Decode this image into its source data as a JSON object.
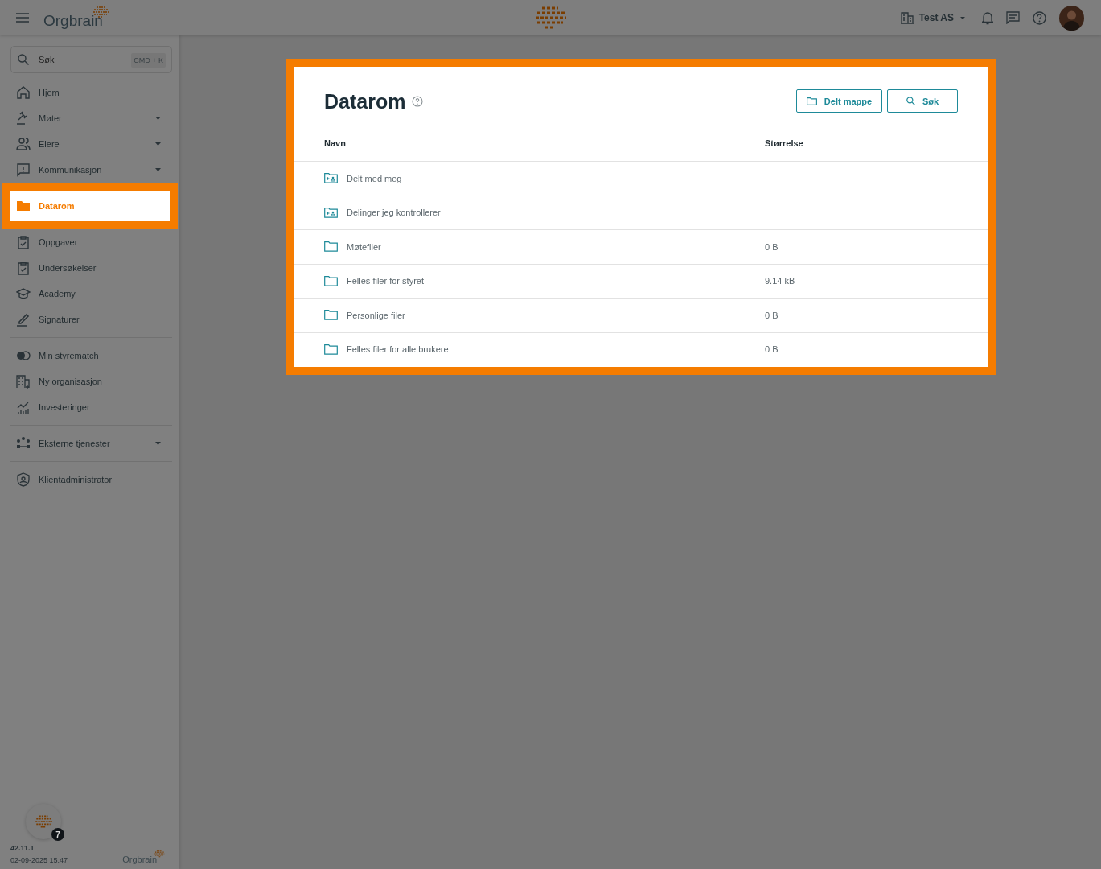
{
  "header": {
    "logo": "Orgbrain",
    "org": "Test AS"
  },
  "search": {
    "placeholder": "Søk",
    "shortcut": "CMD + K"
  },
  "nav_groups": [
    [
      {
        "label": "Hjem",
        "expandable": false,
        "selected": false
      },
      {
        "label": "Møter",
        "expandable": true,
        "selected": false
      },
      {
        "label": "Eiere",
        "expandable": true,
        "selected": false
      },
      {
        "label": "Kommunikasjon",
        "expandable": true,
        "selected": false
      },
      {
        "label": "Datarom",
        "expandable": false,
        "selected": true
      },
      {
        "label": "Oppgaver",
        "expandable": false,
        "selected": false
      },
      {
        "label": "Undersøkelser",
        "expandable": false,
        "selected": false
      },
      {
        "label": "Academy",
        "expandable": false,
        "selected": false
      },
      {
        "label": "Signaturer",
        "expandable": false,
        "selected": false
      }
    ],
    [
      {
        "label": "Min styrematch",
        "expandable": false,
        "selected": false
      },
      {
        "label": "Ny organisasjon",
        "expandable": false,
        "selected": false
      },
      {
        "label": "Investeringer",
        "expandable": false,
        "selected": false
      }
    ],
    [
      {
        "label": "Eksterne tjenester",
        "expandable": true,
        "selected": false
      }
    ],
    [
      {
        "label": "Klientadministrator",
        "expandable": false,
        "selected": false
      }
    ]
  ],
  "footer": {
    "badge": "7",
    "version": "42.11.1",
    "timestamp": "02-09-2025 15:47",
    "logo": "Orgbrain"
  },
  "page": {
    "title": "Datarom",
    "buttons": [
      {
        "kind": "folder",
        "label": "Delt mappe"
      },
      {
        "kind": "search",
        "label": "Søk"
      }
    ],
    "table": {
      "columns": [
        "Navn",
        "Størrelse"
      ],
      "rows": [
        {
          "kind": "shared",
          "name": "Delt med meg"
        },
        {
          "kind": "shared",
          "name": "Delinger jeg kontrollerer"
        },
        {
          "kind": "folder",
          "name": "Møtefiler",
          "size": "0 B"
        },
        {
          "kind": "folder",
          "name": "Felles filer for styret",
          "size": "9.14 kB"
        },
        {
          "kind": "folder",
          "name": "Personlige filer",
          "size": "0 B"
        },
        {
          "kind": "folder",
          "name": "Felles filer for alle brukere",
          "size": "0 B"
        }
      ]
    }
  }
}
